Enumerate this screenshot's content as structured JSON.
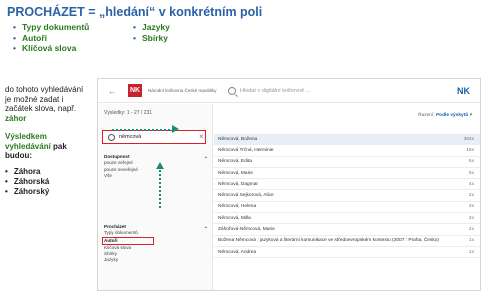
{
  "slide": {
    "title": "PROCHÁZET = „hledání“ v konkrétním poli",
    "bullets": [
      [
        "Typy dokumentů",
        "Jazyky"
      ],
      [
        "Autoři",
        "Sbírky"
      ],
      [
        "Klíčová slova",
        ""
      ]
    ],
    "left_text": {
      "intro": "do tohoto vyhledávání je možné zadat i začátek slova, např.",
      "intro_example": "záhor",
      "result_lead": "Výsledkem vyhledávání",
      "result_tail": " pak budou:",
      "results": [
        "Záhora",
        "Záhorská",
        "Záhorský"
      ]
    },
    "accent_colors": {
      "title": "#2a62a8",
      "green": "#2a7a1e",
      "highlight": "#d8212a",
      "arrow": "#1d8a78"
    }
  },
  "app": {
    "library_name": "Národní knihovna České republiky",
    "logo_text": "NK",
    "search_placeholder": "Hledat v digitální knihovně ...",
    "brand": "NK",
    "results_count": "Výsledky: 1 - 27 / 231",
    "facet_search_value": "němcová",
    "facet_close": "×",
    "sort_label": "Řazení:",
    "sort_value": "Podle výskytů",
    "facets": {
      "dostupnost": {
        "label": "Dostupnost",
        "items": [
          "pouze veřejné",
          "pouze neveřejné",
          "Vše"
        ]
      },
      "prochazet": {
        "label": "Procházet",
        "items": [
          "Typy dokumentů",
          "Autoři",
          "Klíčová slova",
          "Sbírky",
          "Jazyky"
        ],
        "selected_index": 1
      }
    },
    "rows": [
      {
        "name": "Němcová, Božena",
        "count": "364x"
      },
      {
        "name": "Němcová Trčná, Herminie",
        "count": "16x"
      },
      {
        "name": "Němcová, Edita",
        "count": "6x"
      },
      {
        "name": "Němcová, Marie",
        "count": "5x"
      },
      {
        "name": "Němcová, Dagmar",
        "count": "4x"
      },
      {
        "name": "Němcová Sejkorová, Alice",
        "count": "2x"
      },
      {
        "name": "Němcová, Helena",
        "count": "2x"
      },
      {
        "name": "Němcová, Milla",
        "count": "2x"
      },
      {
        "name": "Záhořová-Němcová, Marie",
        "count": "2x"
      },
      {
        "name": "Božena Němcová : jazyková a literární komunikace ve středoevropském kontextu (2007 : Praha, Česko)",
        "count": "1x"
      },
      {
        "name": "Němcová, Andrea",
        "count": "1x"
      }
    ]
  }
}
